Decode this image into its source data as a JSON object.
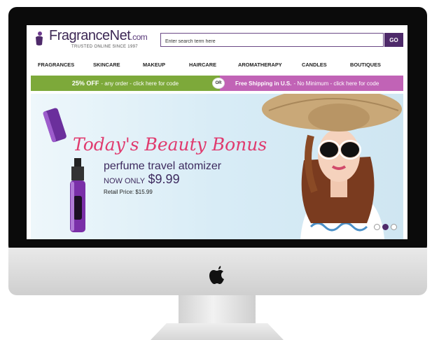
{
  "header": {
    "brand_name": "FragranceNet",
    "brand_tld": ".com",
    "tagline": "TRUSTED ONLINE SINCE 1997"
  },
  "search": {
    "placeholder": "Enter search term here",
    "button_label": "GO"
  },
  "nav": {
    "items": [
      {
        "label": "FRAGRANCES"
      },
      {
        "label": "SKINCARE"
      },
      {
        "label": "MAKEUP"
      },
      {
        "label": "HAIRCARE"
      },
      {
        "label": "AROMATHERAPY"
      },
      {
        "label": "CANDLES"
      },
      {
        "label": "BOUTIQUES"
      }
    ]
  },
  "promos": {
    "left_strong": "25% OFF",
    "left_text": "- any order - click here for code",
    "or_badge": "OR",
    "right_strong": "Free Shipping in U.S.",
    "right_text": "- No Minimum - click here for code"
  },
  "hero": {
    "title": "Today's Beauty Bonus",
    "product": "perfume travel atomizer",
    "now_only_label": "NOW ONLY",
    "price": "$9.99",
    "retail_price": "Retail Price: $15.99",
    "slides_total": 3,
    "active_slide": 2
  },
  "colors": {
    "brand_purple": "#4e2a6a",
    "promo_green": "#7da93a",
    "promo_pink": "#c163b6",
    "bonus_pink": "#e03a6e"
  },
  "icons": [
    "perfume-bottle-logo-icon",
    "apple-logo-icon"
  ]
}
